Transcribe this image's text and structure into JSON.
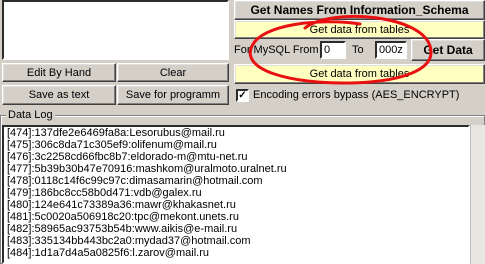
{
  "buttons": {
    "get_names": "Get Names From Information_Schema",
    "get_data_from_tables_top": "Get data from tables",
    "get_data": "Get Data",
    "get_data_from_tables": "Get data from tables",
    "edit_by_hand": "Edit By Hand",
    "clear": "Clear",
    "save_as_text": "Save as text",
    "save_for_programm": "Save for programm"
  },
  "range": {
    "label_for": "For MySQL From",
    "from_value": "0",
    "label_to": "To",
    "to_value": "000z"
  },
  "encoding": {
    "checked": true,
    "label": "Encoding errors bypass (AES_ENCRYPT)"
  },
  "log": {
    "title": "Data Log",
    "lines": [
      "[474]:137dfe2e6469fa8a:Lesorubus@mail.ru",
      "[475]:306c8da71c305ef9:olifenum@mail.ru",
      "[476]:3c2258cd66fbc8b7:eldorado-m@mtu-net.ru",
      "[477]:5b39b30b47e70916:mashkom@uralmoto.uralnet.ru",
      "[478]:0118c14f6c99c97c:dimasamarin@hotmail.com",
      "[479]:186bc8cc58b0d471:vdb@galex.ru",
      "[480]:124e641c73389a36:mawr@khakasnet.ru",
      "[481]:5c0020a506918c20:tpc@mekont.unets.ru",
      "[482]:58965ac93753b54b:www.aikis@e-mail.ru",
      "[483]:335134bb443bc2a0:mydad37@hotmail.com",
      "[484]:1d1a7d4a5a0825f6:l.zarov@mail.ru"
    ]
  },
  "colors": {
    "window_bg": "#d4d0c8",
    "highlight_button": "#ffffc0",
    "annotation_red": "#e81010"
  }
}
